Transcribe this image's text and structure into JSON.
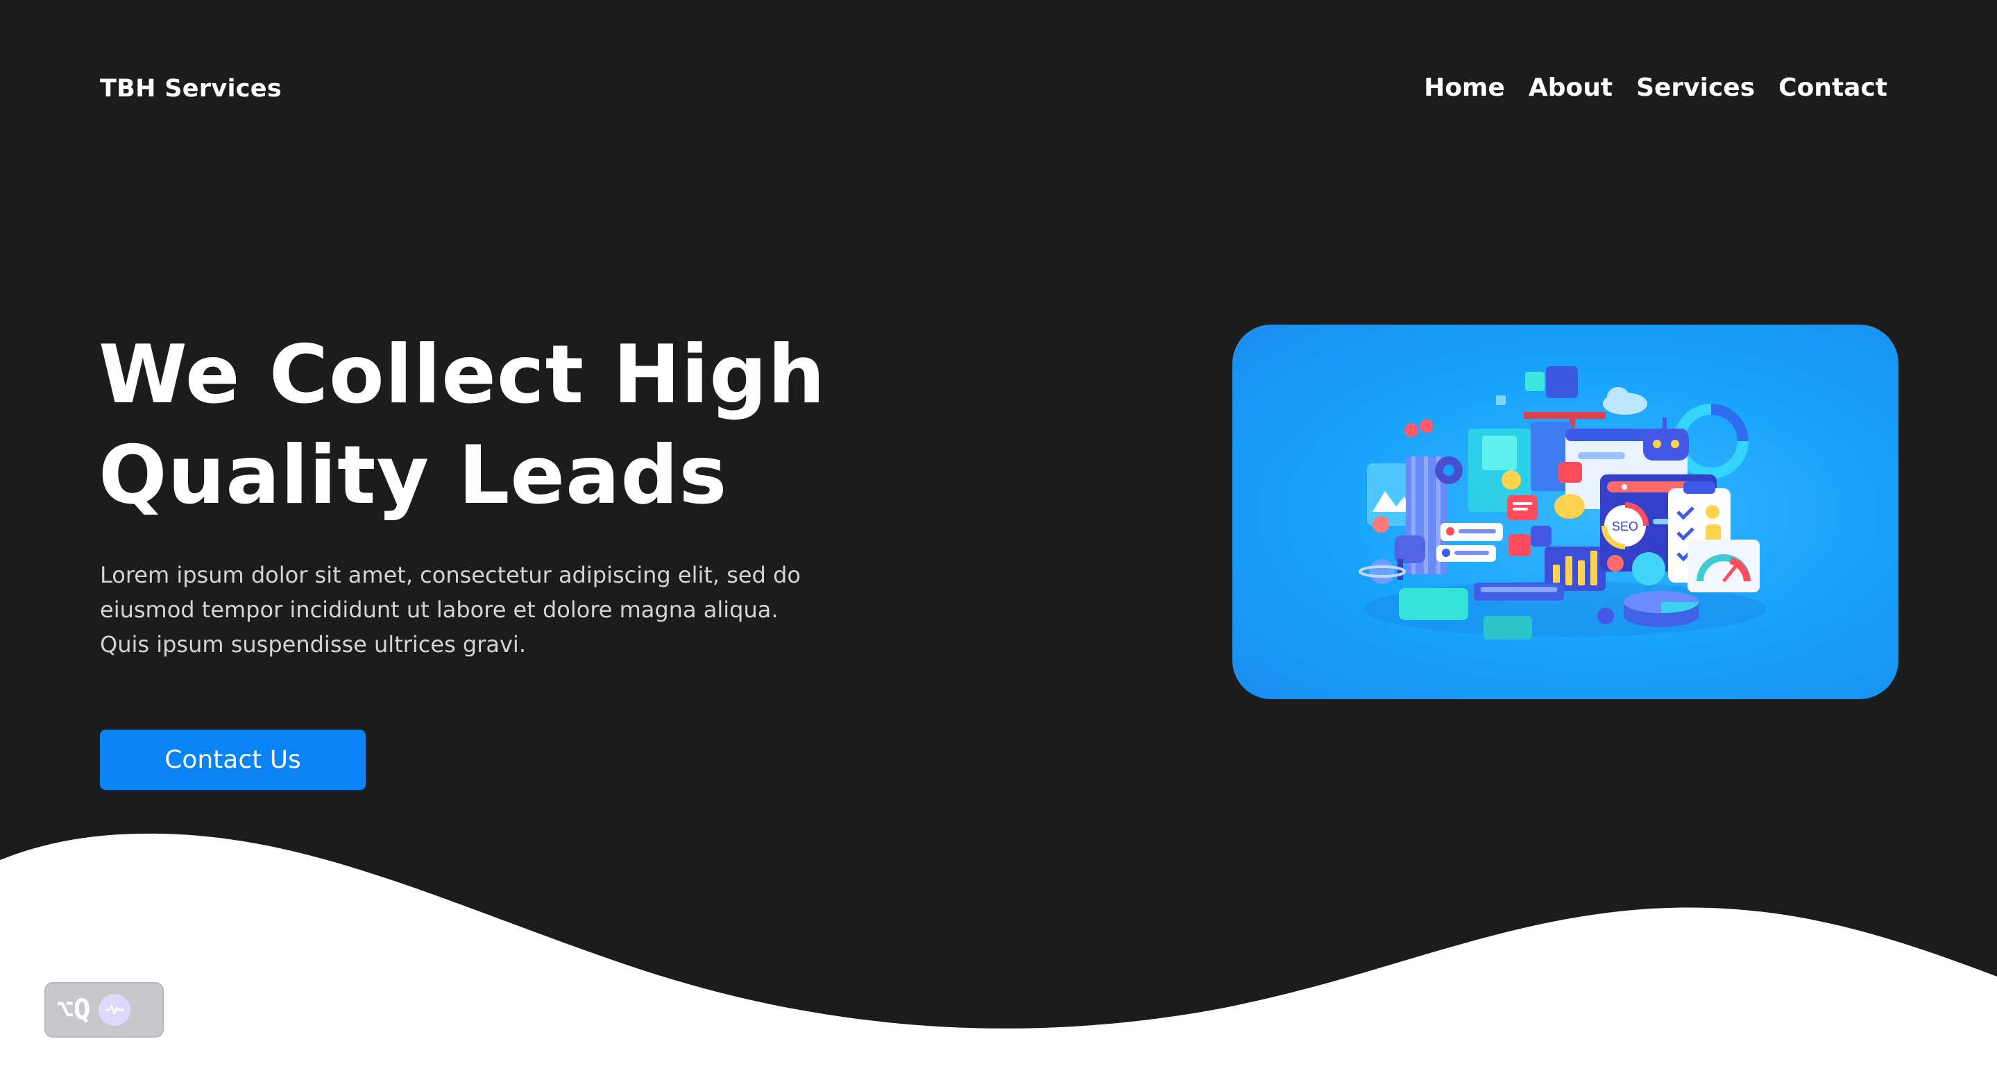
{
  "header": {
    "brand": "TBH Services",
    "nav": [
      {
        "label": "Home"
      },
      {
        "label": "About"
      },
      {
        "label": "Services"
      },
      {
        "label": "Contact"
      }
    ]
  },
  "hero": {
    "headline_line1": "We Collect High",
    "headline_line2": "Quality Leads",
    "description": "Lorem ipsum dolor sit amet, consectetur adipiscing elit, sed do eiusmod tempor incididunt ut labore et dolore magna aliqua. Quis ipsum suspendisse ultrices gravi.",
    "cta_label": "Contact Us",
    "illustration_badge": "SEO"
  },
  "shortcut_badge": {
    "keys": "⌥Q",
    "icon": "waveform-icon"
  },
  "colors": {
    "background_dark": "#1c1c1d",
    "accent": "#0a84f5",
    "card_blue": "#16a2fb",
    "text_light": "#ffffff",
    "text_muted": "#d4d4d4"
  }
}
